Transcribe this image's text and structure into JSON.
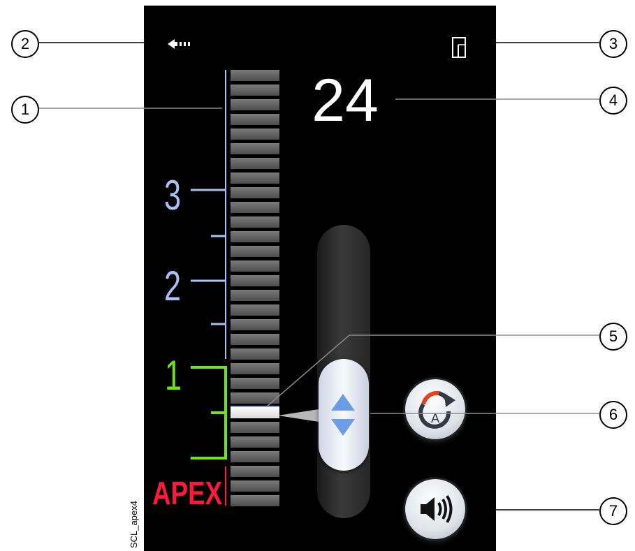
{
  "screen": {
    "readout_value": "24",
    "back_icon": "back-arrow-icon",
    "door_icon": "door-icon",
    "scale_labels": {
      "three": "3",
      "two": "2",
      "one": "1",
      "apex": "APEX"
    },
    "segment_count": 30,
    "active_segment_index": 23,
    "colors": {
      "scale_blue": "#a9c0f5",
      "scale_green": "#6ee21b",
      "apex_red": "#ff1a3c",
      "stepper_arrow": "#6d9ce6"
    },
    "buttons": {
      "auto_reverse_icon": "auto-reverse-icon",
      "auto_reverse_letter": "A",
      "sound_icon": "speaker-icon"
    }
  },
  "callouts": [
    "1",
    "2",
    "3",
    "4",
    "5",
    "6",
    "7"
  ],
  "side_caption": "SCL_apex4"
}
